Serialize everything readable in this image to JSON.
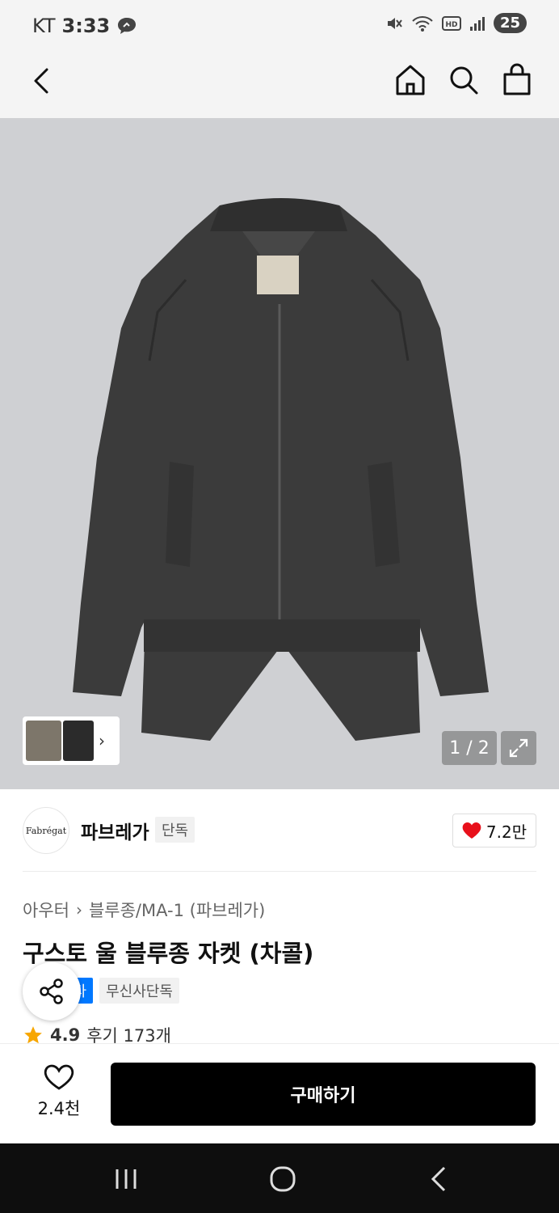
{
  "status": {
    "carrier": "KT",
    "time": "3:33",
    "battery": "25"
  },
  "gallery": {
    "counter": "1 / 2"
  },
  "brand": {
    "logo_text": "Fabrégat",
    "name": "파브레가",
    "tag": "단독",
    "likes": "7.2만"
  },
  "product": {
    "breadcrumb": [
      "아우터",
      "블루종/MA-1 (파브레가)"
    ],
    "title": "구스토 울 블루종 자켓 (차콜)",
    "tag_blue": "스타",
    "tag_gray": "무신사단독",
    "rating": "4.9",
    "reviews": "후기 173개"
  },
  "bottom": {
    "wish_count": "2.4천",
    "buy_label": "구매하기"
  },
  "colors": {
    "accent_blue": "#0078ff",
    "heart_red": "#e8101b",
    "star_orange": "#f7a600",
    "buy_bg": "#000000"
  }
}
